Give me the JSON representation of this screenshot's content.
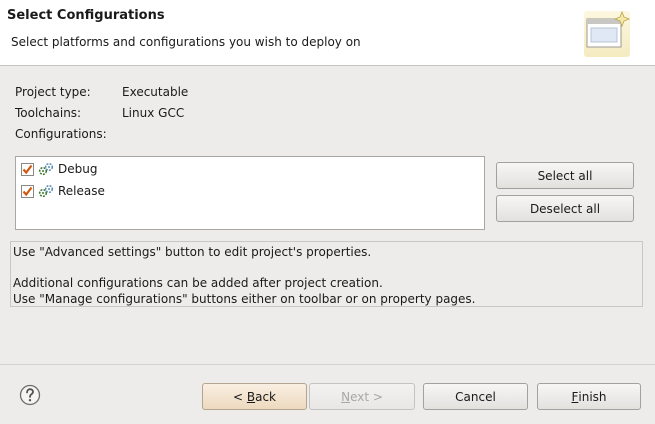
{
  "header": {
    "title": "Select Configurations",
    "description": "Select platforms and configurations you wish to deploy on"
  },
  "info": {
    "project_type_label": "Project type:",
    "project_type_value": "Executable",
    "toolchains_label": "Toolchains:",
    "toolchains_value": "Linux GCC",
    "configurations_label": "Configurations:"
  },
  "configurations": [
    {
      "label": "Debug",
      "checked": true
    },
    {
      "label": "Release",
      "checked": true
    }
  ],
  "side_buttons": {
    "select_all": "Select all",
    "deselect_all": "Deselect all"
  },
  "hints": {
    "line1": "Use \"Advanced settings\" button to edit project's properties.",
    "line2": "Additional configurations can be added after project creation.",
    "line3": "Use \"Manage configurations\" buttons either on toolbar or on property pages."
  },
  "footer": {
    "back_prefix": "< ",
    "back_mnemonic": "B",
    "back_rest": "ack",
    "next_mnemonic": "N",
    "next_rest": "ext >",
    "cancel": "Cancel",
    "finish_mnemonic": "F",
    "finish_rest": "inish"
  },
  "colors": {
    "checkbox_mark": "#d0580e",
    "config_icon": "#3a7a2e"
  }
}
